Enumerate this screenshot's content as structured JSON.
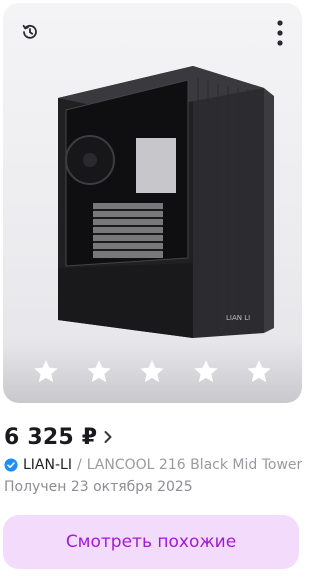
{
  "product": {
    "price": "6 325 ₽",
    "brand": "LIAN-LI",
    "separator": "/",
    "name": "LANCOOL 216 Black Mid Tower",
    "received": "Получен 23 октября 2025",
    "case_logo": "LIAN LI",
    "rating_stars": 5
  },
  "actions": {
    "similar_label": "Смотреть похожие"
  },
  "colors": {
    "accent": "#a319d6",
    "button_bg": "#f3dcfb",
    "verified": "#1e8ef5"
  }
}
